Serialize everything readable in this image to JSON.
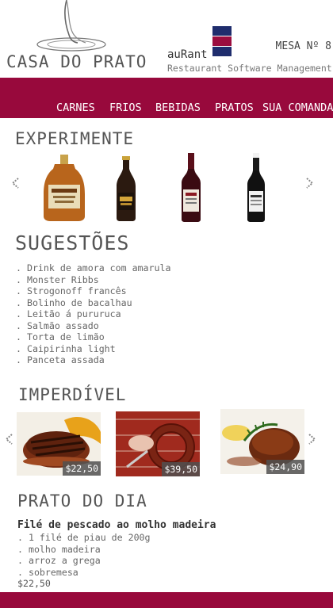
{
  "header": {
    "restaurant_name": "CASA DO PRATO",
    "brand": "auRant",
    "tagline": "Restaurant Software Management",
    "table_label": "MESA Nº 8"
  },
  "nav": {
    "items": [
      "CARNES",
      "FRIOS",
      "BEBIDAS",
      "PRATOS",
      "SUA COMANDA"
    ]
  },
  "experimente": {
    "title": "EXPERIMENTE",
    "products": [
      {
        "icon": "whisky-bottle-icon"
      },
      {
        "icon": "dark-beer-bottle-icon"
      },
      {
        "icon": "red-wine-bottle-icon"
      },
      {
        "icon": "port-wine-bottle-icon"
      }
    ]
  },
  "sugestoes": {
    "title": "SUGESTÕES",
    "items": [
      ". Drink de amora com amarula",
      ". Monster Ribbs",
      ". Strogonoff francês",
      ". Bolinho de bacalhau",
      ". Leitão á pururuca",
      ". Salmão assado",
      ". Torta de limão",
      ". Caipirinha light",
      ". Panceta assada"
    ]
  },
  "imperdivel": {
    "title": "IMPERDÍVEL",
    "dishes": [
      {
        "icon": "bacon-wrapped-steak-image",
        "price": "$22,50"
      },
      {
        "icon": "grilled-sausage-image",
        "price": "$39,50"
      },
      {
        "icon": "roast-meat-plate-image",
        "price": "$24,90"
      }
    ]
  },
  "prato_do_dia": {
    "title": "PRATO DO DIA",
    "dish_name": "Filé de pescado ao molho madeira",
    "items": [
      ". 1 filé de piau de 200g",
      ". molho madeira",
      ". arroz a grega",
      ". sobremesa"
    ],
    "price": "$22,50"
  },
  "colors": {
    "brand_red": "#98093c",
    "flag_blue": "#1f2d6d",
    "flag_red": "#9b0d3f"
  }
}
